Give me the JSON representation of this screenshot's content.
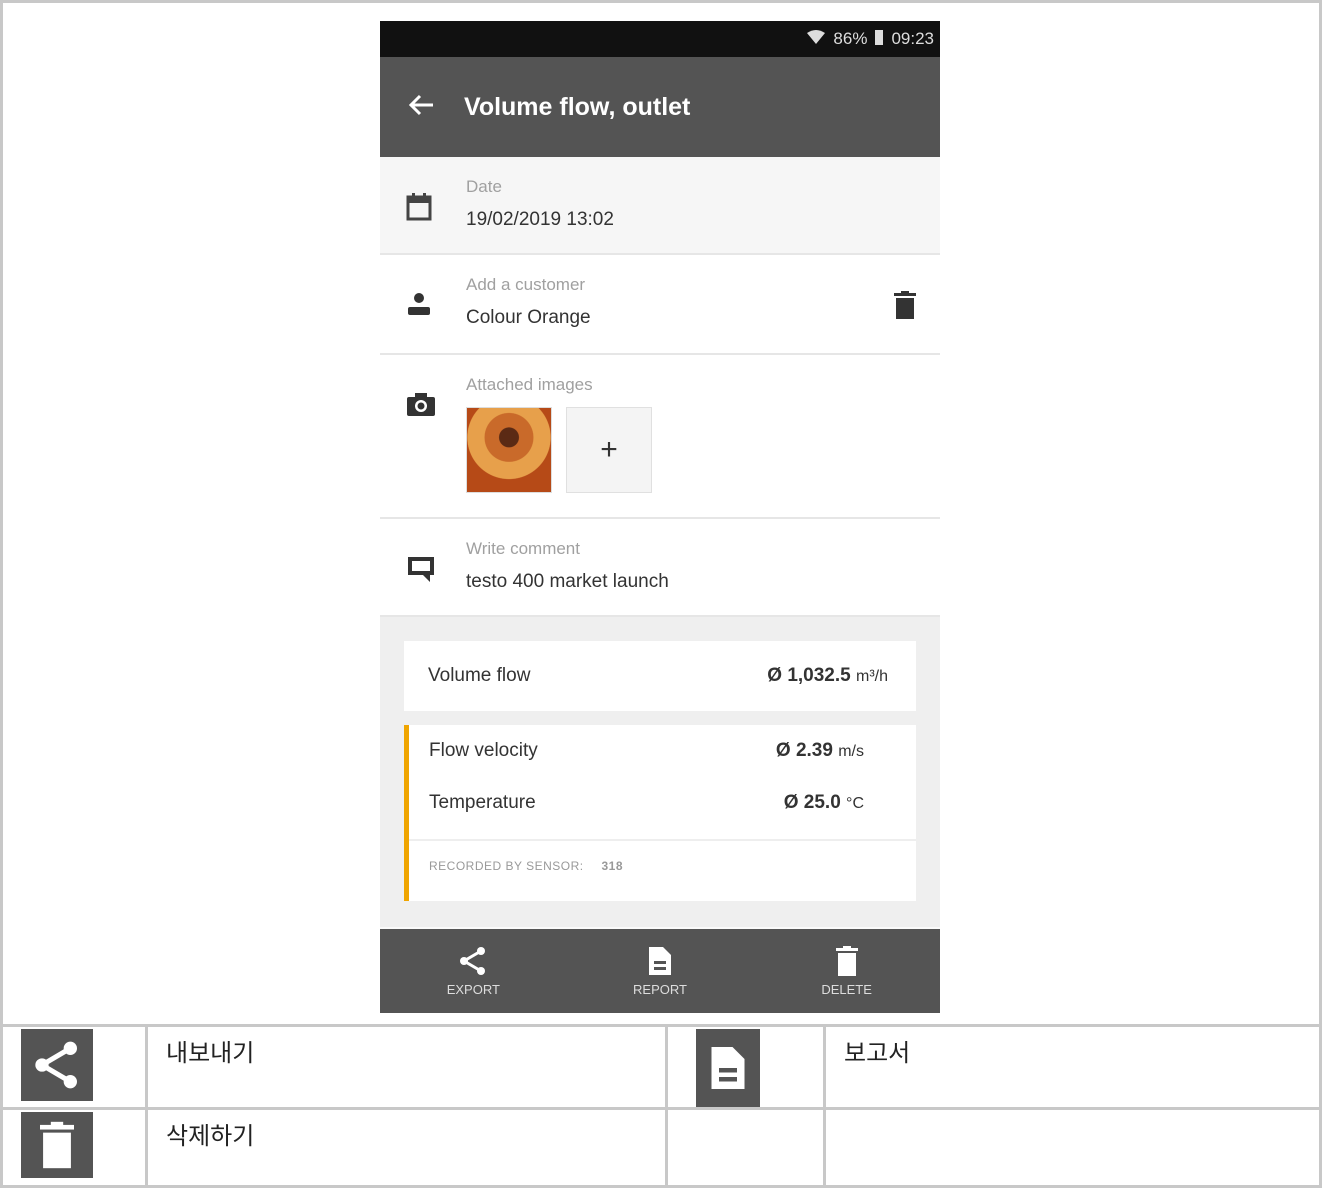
{
  "status_bar": {
    "battery": "86%",
    "time": "09:23"
  },
  "app_bar": {
    "title": "Volume flow, outlet"
  },
  "date_row": {
    "label": "Date",
    "value": "19/02/2019 13:02"
  },
  "customer_row": {
    "label": "Add a customer",
    "value": "Colour Orange"
  },
  "images_row": {
    "label": "Attached images",
    "add_symbol": "+"
  },
  "comment_row": {
    "label": "Write comment",
    "value": "testo 400 market launch"
  },
  "results": {
    "volume_flow": {
      "label": "Volume flow",
      "value": "Ø 1,032.5",
      "unit": "m³/h"
    },
    "flow_velocity": {
      "label": "Flow velocity",
      "value": "Ø 2.39",
      "unit": "m/s"
    },
    "temperature": {
      "label": "Temperature",
      "value": "Ø 25.0",
      "unit": "°C"
    },
    "recorded_by": "RECORDED BY SENSOR:",
    "sensor_id": "318"
  },
  "bottom_bar": {
    "export": "EXPORT",
    "report": "REPORT",
    "delete": "DELETE"
  },
  "legend": {
    "export": "내보내기",
    "report": "보고서",
    "delete": "삭제하기"
  },
  "colors": {
    "app_bar": "#545454",
    "accent": "#f0a500"
  }
}
